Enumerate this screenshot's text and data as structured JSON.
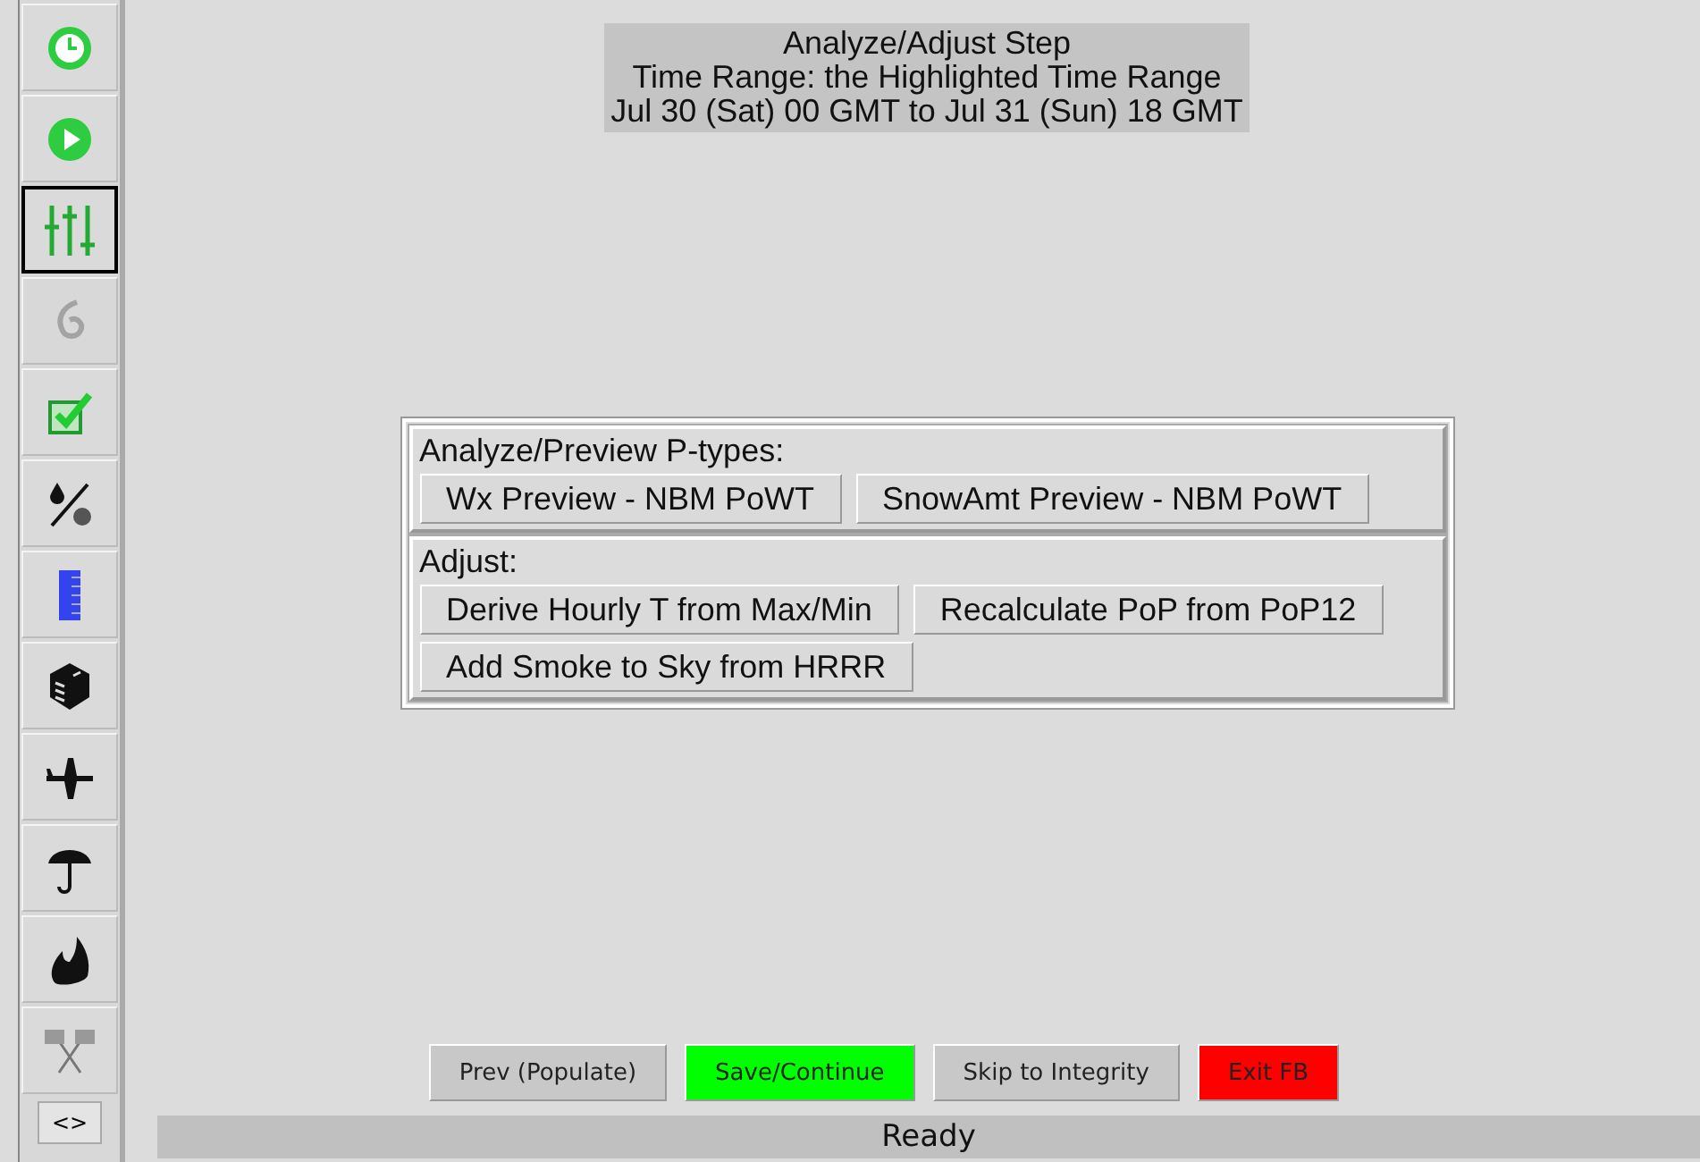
{
  "toolbar": [
    {
      "kind": "clock",
      "selected": false,
      "disabled": false
    },
    {
      "kind": "play",
      "selected": false,
      "disabled": false
    },
    {
      "kind": "sliders",
      "selected": true,
      "disabled": false
    },
    {
      "kind": "hurricane",
      "selected": false,
      "disabled": true
    },
    {
      "kind": "checkbox",
      "selected": false,
      "disabled": false
    },
    {
      "kind": "drop-ratio",
      "selected": false,
      "disabled": false
    },
    {
      "kind": "ruler",
      "selected": false,
      "disabled": false
    },
    {
      "kind": "dice",
      "selected": false,
      "disabled": false
    },
    {
      "kind": "plane",
      "selected": false,
      "disabled": false
    },
    {
      "kind": "umbrella",
      "selected": false,
      "disabled": false
    },
    {
      "kind": "fire",
      "selected": false,
      "disabled": false
    },
    {
      "kind": "flags",
      "selected": false,
      "disabled": false
    }
  ],
  "toggle_button": "<>",
  "header": [
    "Analyze/Adjust Step",
    "Time Range:  the Highlighted Time Range",
    "Jul 30 (Sat) 00 GMT to Jul 31 (Sun) 18 GMT"
  ],
  "groups": [
    {
      "title": "Analyze/Preview P-types:",
      "buttons": [
        "Wx Preview - NBM PoWT",
        "SnowAmt Preview - NBM PoWT"
      ]
    },
    {
      "title": "Adjust:",
      "buttons": [
        "Derive Hourly T from Max/Min",
        "Recalculate PoP from PoP12",
        "Add Smoke to Sky from HRRR"
      ]
    }
  ],
  "nav_buttons": [
    {
      "label": "Prev (Populate)",
      "color": "#c8c8c8"
    },
    {
      "label": "Save/Continue",
      "color": "#00ff00"
    },
    {
      "label": "Skip to Integrity",
      "color": "#c8c8c8"
    },
    {
      "label": "Exit FB",
      "color": "#ff0000"
    }
  ],
  "status_bar": "Ready"
}
